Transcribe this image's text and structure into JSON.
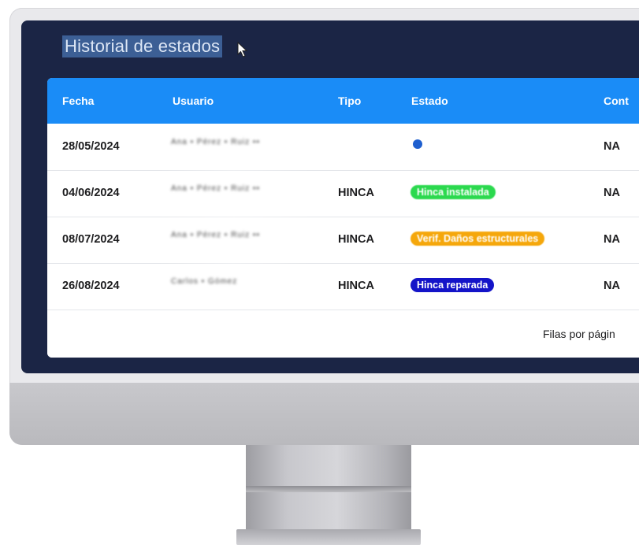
{
  "page": {
    "title": "Historial de estados"
  },
  "table": {
    "columns": [
      "Fecha",
      "Usuario",
      "Tipo",
      "Estado",
      "Cont"
    ],
    "rows": [
      {
        "fecha": "28/05/2024",
        "usuario": "Ana ▪ Pérez ▪ Ruiz ▪▪",
        "tipo": "",
        "estado": "",
        "estado_color": "#1e5fcf",
        "cont": "NA"
      },
      {
        "fecha": "04/06/2024",
        "usuario": "Ana ▪ Pérez ▪ Ruiz ▪▪",
        "tipo": "HINCA",
        "estado": "Hinca instalada",
        "estado_color": "#2bd94e",
        "cont": "NA"
      },
      {
        "fecha": "08/07/2024",
        "usuario": "Ana ▪ Pérez ▪ Ruiz ▪▪",
        "tipo": "HINCA",
        "estado": "Verif. Daños estructurales",
        "estado_color": "#f5a70b",
        "cont": "NA"
      },
      {
        "fecha": "26/08/2024",
        "usuario": "Carlos ▪ Gómez",
        "tipo": "HINCA",
        "estado": "Hinca reparada",
        "estado_color": "#1414c8",
        "cont": "NA"
      }
    ]
  },
  "footer": {
    "rows_per_page_label": "Filas por págin"
  },
  "colors": {
    "screen_bg": "#1b2545",
    "header_bg": "#1a8cf7",
    "title_highlight": "#3c5f95"
  },
  "icons": {
    "cursor": "arrow-cursor-icon"
  }
}
